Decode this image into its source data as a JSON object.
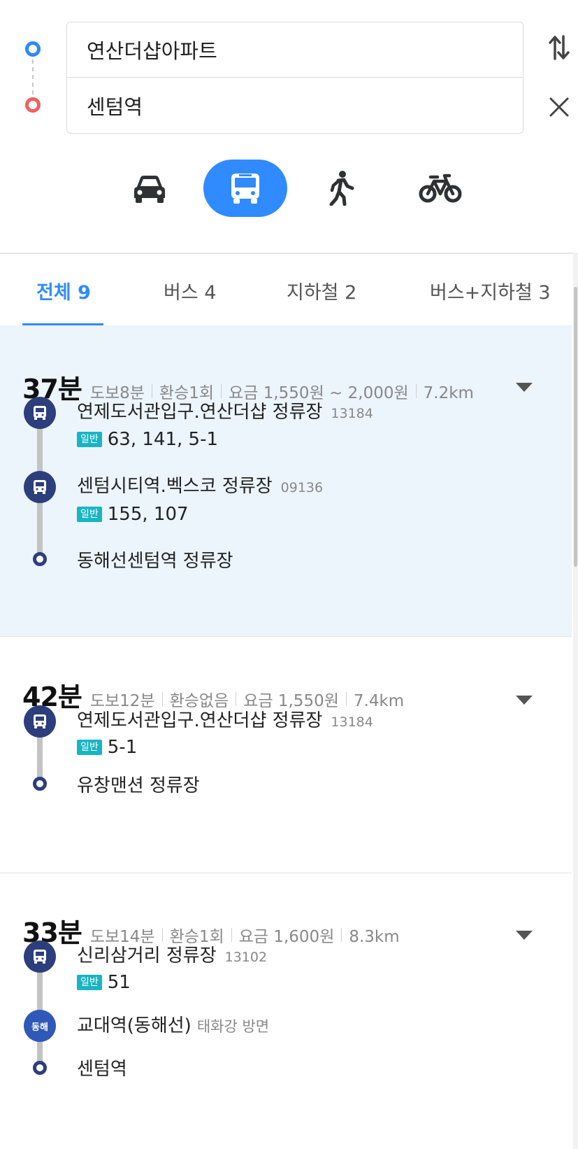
{
  "search": {
    "origin": "연산더샵아파트",
    "destination": "센텀역"
  },
  "modes": [
    {
      "icon": "car-icon"
    },
    {
      "icon": "bus-icon",
      "active": true
    },
    {
      "icon": "walk-icon"
    },
    {
      "icon": "bike-icon"
    }
  ],
  "tabs": [
    {
      "label": "전체 9",
      "active": true
    },
    {
      "label": "버스 4"
    },
    {
      "label": "지하철 2"
    },
    {
      "label": "버스+지하철 3"
    }
  ],
  "colors": {
    "accent": "#2f8bff",
    "selected_bg": "#ecf4fc",
    "bus_badge": "#2d3e7c",
    "bus_type": "#18b5c4",
    "rail_badge": "#2f59b8"
  },
  "routes": [
    {
      "duration": "37분",
      "walk": "도보8분",
      "transfer": "환승1회",
      "fare": "요금 1,550원 ~ 2,000원",
      "distance": "7.2km",
      "steps": [
        {
          "stop": "연제도서관입구.연산더샵 정류장",
          "stop_id": "13184",
          "bus_type": "일반",
          "buses": "63, 141, 5-1"
        },
        {
          "stop": "센텀시티역.벡스코 정류장",
          "stop_id": "09136",
          "bus_type": "일반",
          "buses": "155, 107"
        }
      ],
      "arrival": "동해선센텀역 정류장"
    },
    {
      "duration": "42분",
      "walk": "도보12분",
      "transfer": "환승없음",
      "fare": "요금 1,550원",
      "distance": "7.4km",
      "steps": [
        {
          "stop": "연제도서관입구.연산더샵 정류장",
          "stop_id": "13184",
          "bus_type": "일반",
          "buses": "5-1"
        }
      ],
      "arrival": "유창맨션 정류장"
    },
    {
      "duration": "33분",
      "walk": "도보14분",
      "transfer": "환승1회",
      "fare": "요금 1,600원",
      "distance": "8.3km",
      "steps": [
        {
          "stop": "신리삼거리 정류장",
          "stop_id": "13102",
          "bus_type": "일반",
          "buses": "51"
        }
      ],
      "rail": {
        "badge": "동해",
        "station": "교대역(동해선)",
        "direction": "태화강 방면"
      },
      "arrival": "센텀역"
    }
  ]
}
